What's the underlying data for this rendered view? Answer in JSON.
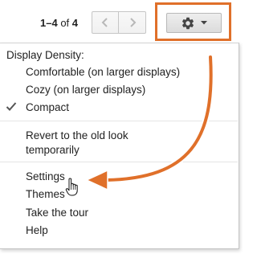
{
  "toolbar": {
    "range": "1–4",
    "of_word": " of ",
    "total": "4",
    "prev_icon": "chevron-left-icon",
    "next_icon": "chevron-right-icon",
    "settings_icon": "gear-icon",
    "dropdown_icon": "caret-down-icon"
  },
  "menu": {
    "density_heading": "Display Density:",
    "density_options": [
      {
        "label": "Comfortable (on larger displays)",
        "checked": false
      },
      {
        "label": "Cozy (on larger displays)",
        "checked": false
      },
      {
        "label": "Compact",
        "checked": true
      }
    ],
    "revert": {
      "line1": "Revert to the old look",
      "line2": "temporarily"
    },
    "items": [
      {
        "label": "Settings"
      },
      {
        "label": "Themes"
      },
      {
        "label": "Take the tour"
      },
      {
        "label": "Help"
      }
    ]
  },
  "colors": {
    "annotation_accent": "#e0702a",
    "menu_border": "#c4c4c4",
    "text": "#222222"
  }
}
